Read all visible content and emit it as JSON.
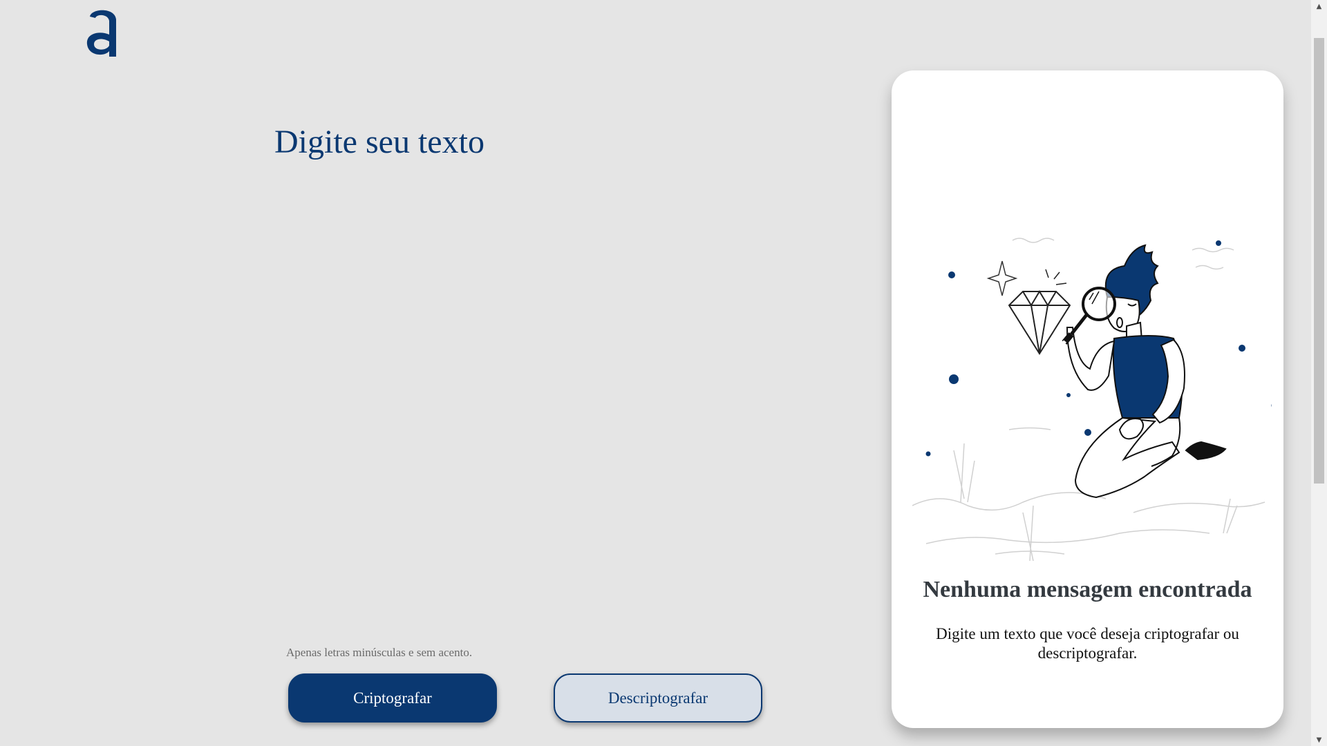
{
  "colors": {
    "brand": "#0a3871",
    "background": "#e5e5e5",
    "card": "#ffffff",
    "secondary_button": "#d8dfe8"
  },
  "header": {
    "logo_icon": "alura-a-logo"
  },
  "main": {
    "input_placeholder": "Digite seu texto",
    "hint_icon": "info-icon",
    "hint_text": "Apenas letras minúsculas e sem acento.",
    "encrypt_label": "Criptografar",
    "decrypt_label": "Descriptografar"
  },
  "output": {
    "illustration": "person-with-magnifying-glass-illustration",
    "title": "Nenhuma mensagem encontrada",
    "text": "Digite um texto que você deseja criptografar ou descriptografar."
  }
}
